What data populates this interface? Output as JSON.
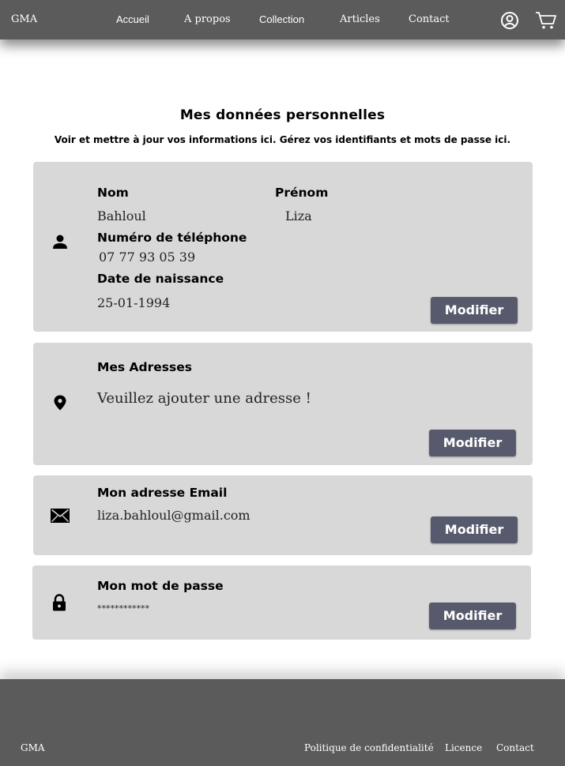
{
  "header": {
    "brand": "GMA",
    "nav": [
      "Accueil",
      "A propos",
      "Collection",
      "Articles",
      "Contact"
    ],
    "icons": [
      "account-icon",
      "cart-icon"
    ]
  },
  "page": {
    "title": "Mes données personnelles",
    "subtitle": "Voir et mettre à jour vos informations ici. Gérez vos identifiants et mots de passe ici."
  },
  "identity": {
    "icon": "person-icon",
    "nom_label": "Nom",
    "nom_value": "Bahloul",
    "prenom_label": "Prénom",
    "prenom_value": "Liza",
    "phone_label": "Numéro de téléphone",
    "phone_value": "07 77 93 05 39",
    "birth_label": "Date de naissance",
    "birth_value": "25-01-1994",
    "button": "Modifier"
  },
  "addresses": {
    "icon": "location-pin-icon",
    "label": "Mes Adresses",
    "value": "Veuillez ajouter une adresse !",
    "button": "Modifier"
  },
  "email": {
    "icon": "envelope-icon",
    "label": "Mon adresse Email",
    "value": "liza.bahloul@gmail.com",
    "button": "Modifier"
  },
  "password": {
    "icon": "lock-icon",
    "label": "Mon mot de passe",
    "value": "************",
    "button": "Modifier"
  },
  "footer": {
    "brand": "GMA",
    "links": [
      "Politique de confidentialité",
      "Licence",
      "Contact"
    ]
  },
  "colors": {
    "bar": "#5b5b5b",
    "card": "#d8d8d8",
    "button": "#575a6c"
  }
}
